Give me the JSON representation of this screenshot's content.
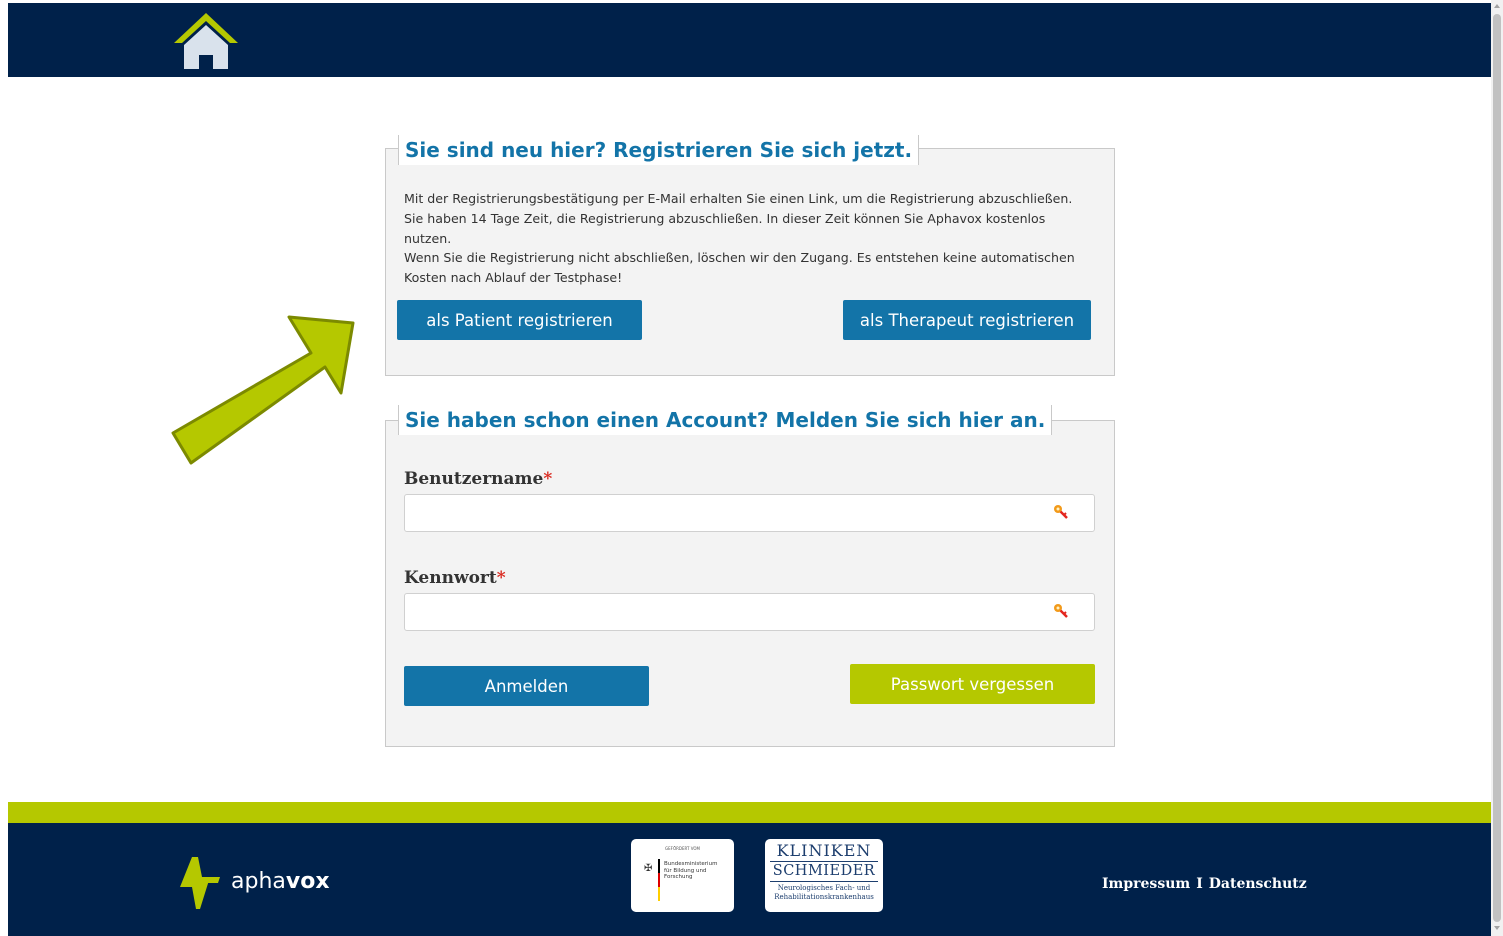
{
  "header": {
    "home_icon": "home-icon"
  },
  "register": {
    "title": "Sie sind neu hier? Registrieren Sie sich jetzt.",
    "paragraph1": "Mit der Registrierungsbestätigung per E-Mail erhalten Sie einen Link, um die Registrierung abzuschließen. Sie haben 14 Tage Zeit, die Registrierung abzuschließen. In dieser Zeit können Sie Aphavox kostenlos nutzen.",
    "paragraph2": "Wenn Sie die Registrierung nicht abschließen, löschen wir den Zugang. Es entstehen keine automatischen Kosten nach Ablauf der Testphase!",
    "patient_button": "als Patient registrieren",
    "therapist_button": "als Therapeut registrieren"
  },
  "login": {
    "title": "Sie haben schon einen Account? Melden Sie sich hier an.",
    "username_label": "Benutzername",
    "password_label": "Kennwort",
    "required_mark": "*",
    "username_value": "",
    "password_value": "",
    "login_button": "Anmelden",
    "forgot_button": "Passwort vergessen"
  },
  "footer": {
    "logo_prefix": "apha",
    "logo_suffix": "vox",
    "bmbf_small": "GEFÖRDERT VOM",
    "bmbf_text": "Bundesministerium für Bildung und Forschung",
    "klinik_line1": "KLINIKEN",
    "klinik_line2": "SCHMIEDER",
    "klinik_line3": "Neurologisches Fach- und Rehabilitationskrankenhaus",
    "impressum": "Impressum",
    "separator": "I",
    "datenschutz": "Datenschutz"
  },
  "colors": {
    "navy": "#00214a",
    "blue_button": "#1374a8",
    "green_accent": "#b5c800",
    "required": "#d9261c"
  }
}
